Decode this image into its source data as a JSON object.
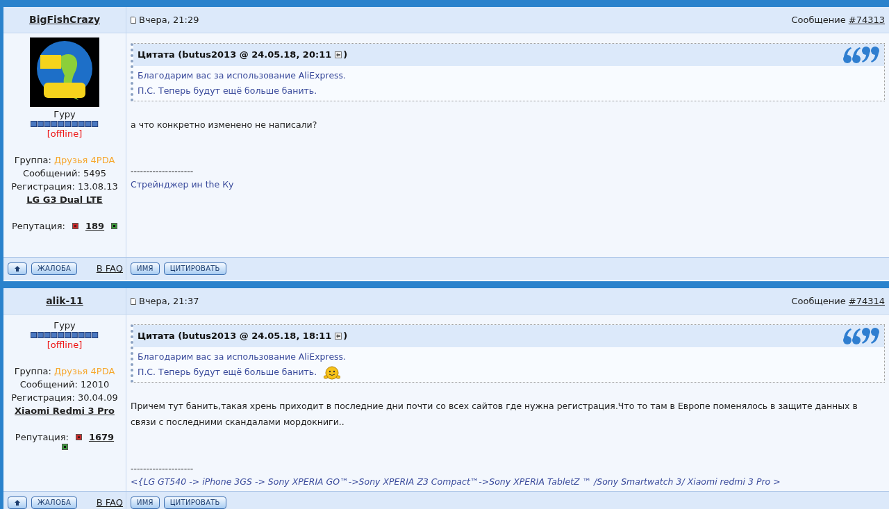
{
  "posts": [
    {
      "author": "BigFishCrazy",
      "has_avatar": true,
      "rank": "Гуру",
      "status": "[offline]",
      "group_label": "Группа:",
      "group": "Друзья 4PDA",
      "messages": "Сообщений: 5495",
      "registration": "Регистрация: 13.08.13",
      "device": "LG G3 Dual LTE",
      "reputation_label": "Репутация:",
      "reputation": "189",
      "date": "Вчера, 21:29",
      "message_label": "Сообщение",
      "message_number": "#74313",
      "quote": {
        "title": "Цитата (butus2013 @ 24.05.18, 20:11",
        "title_end": ")",
        "lines": [
          {
            "text": "Благодарим вас за использование AliExpress.",
            "smiley": false
          },
          {
            "text": "П.С. Теперь будут ещё больше банить.",
            "smiley": false
          }
        ]
      },
      "body": "а что конкретно изменено не написали?",
      "signature_separator": "--------------------",
      "signature": "Стрейнджер ин the Ку",
      "signature_italic": false,
      "buttons": {
        "report": "ЖАЛОБА",
        "faq": "В FAQ",
        "name": "ИМЯ",
        "quote": "ЦИТИРОВАТЬ"
      }
    },
    {
      "author": "alik-11",
      "has_avatar": false,
      "rank": "Гуру",
      "status": "[offline]",
      "group_label": "Группа:",
      "group": "Друзья 4PDA",
      "messages": "Сообщений: 12010",
      "registration": "Регистрация: 30.04.09",
      "device": "Xiaomi Redmi 3 Pro",
      "reputation_label": "Репутация:",
      "reputation": "1679",
      "date": "Вчера, 21:37",
      "message_label": "Сообщение",
      "message_number": "#74314",
      "quote": {
        "title": "Цитата (butus2013 @ 24.05.18, 18:11",
        "title_end": ")",
        "lines": [
          {
            "text": "Благодарим вас за использование AliExpress.",
            "smiley": false
          },
          {
            "text": "П.С. Теперь будут ещё больше банить.",
            "smiley": true
          }
        ]
      },
      "body": "Причем тут банить,такая хрень приходит в последние дни почти со всех сайтов где нужна регистрация.Что то там в Европе поменялось в защите данных в связи с последними скандалами мордокниги..",
      "signature_separator": "--------------------",
      "signature": "<{LG GT540 -> iPhone 3GS -> Sony XPERIA GO™->Sony XPERIA Z3 Compact™->Sony XPERIA TabletZ ™ /Sony Smartwatch 3/ Xiaomi redmi 3 Pro >",
      "signature_italic": true,
      "buttons": {
        "report": "ЖАЛОБА",
        "faq": "В FAQ",
        "name": "ИМЯ",
        "quote": "ЦИТИРОВАТЬ"
      }
    }
  ]
}
